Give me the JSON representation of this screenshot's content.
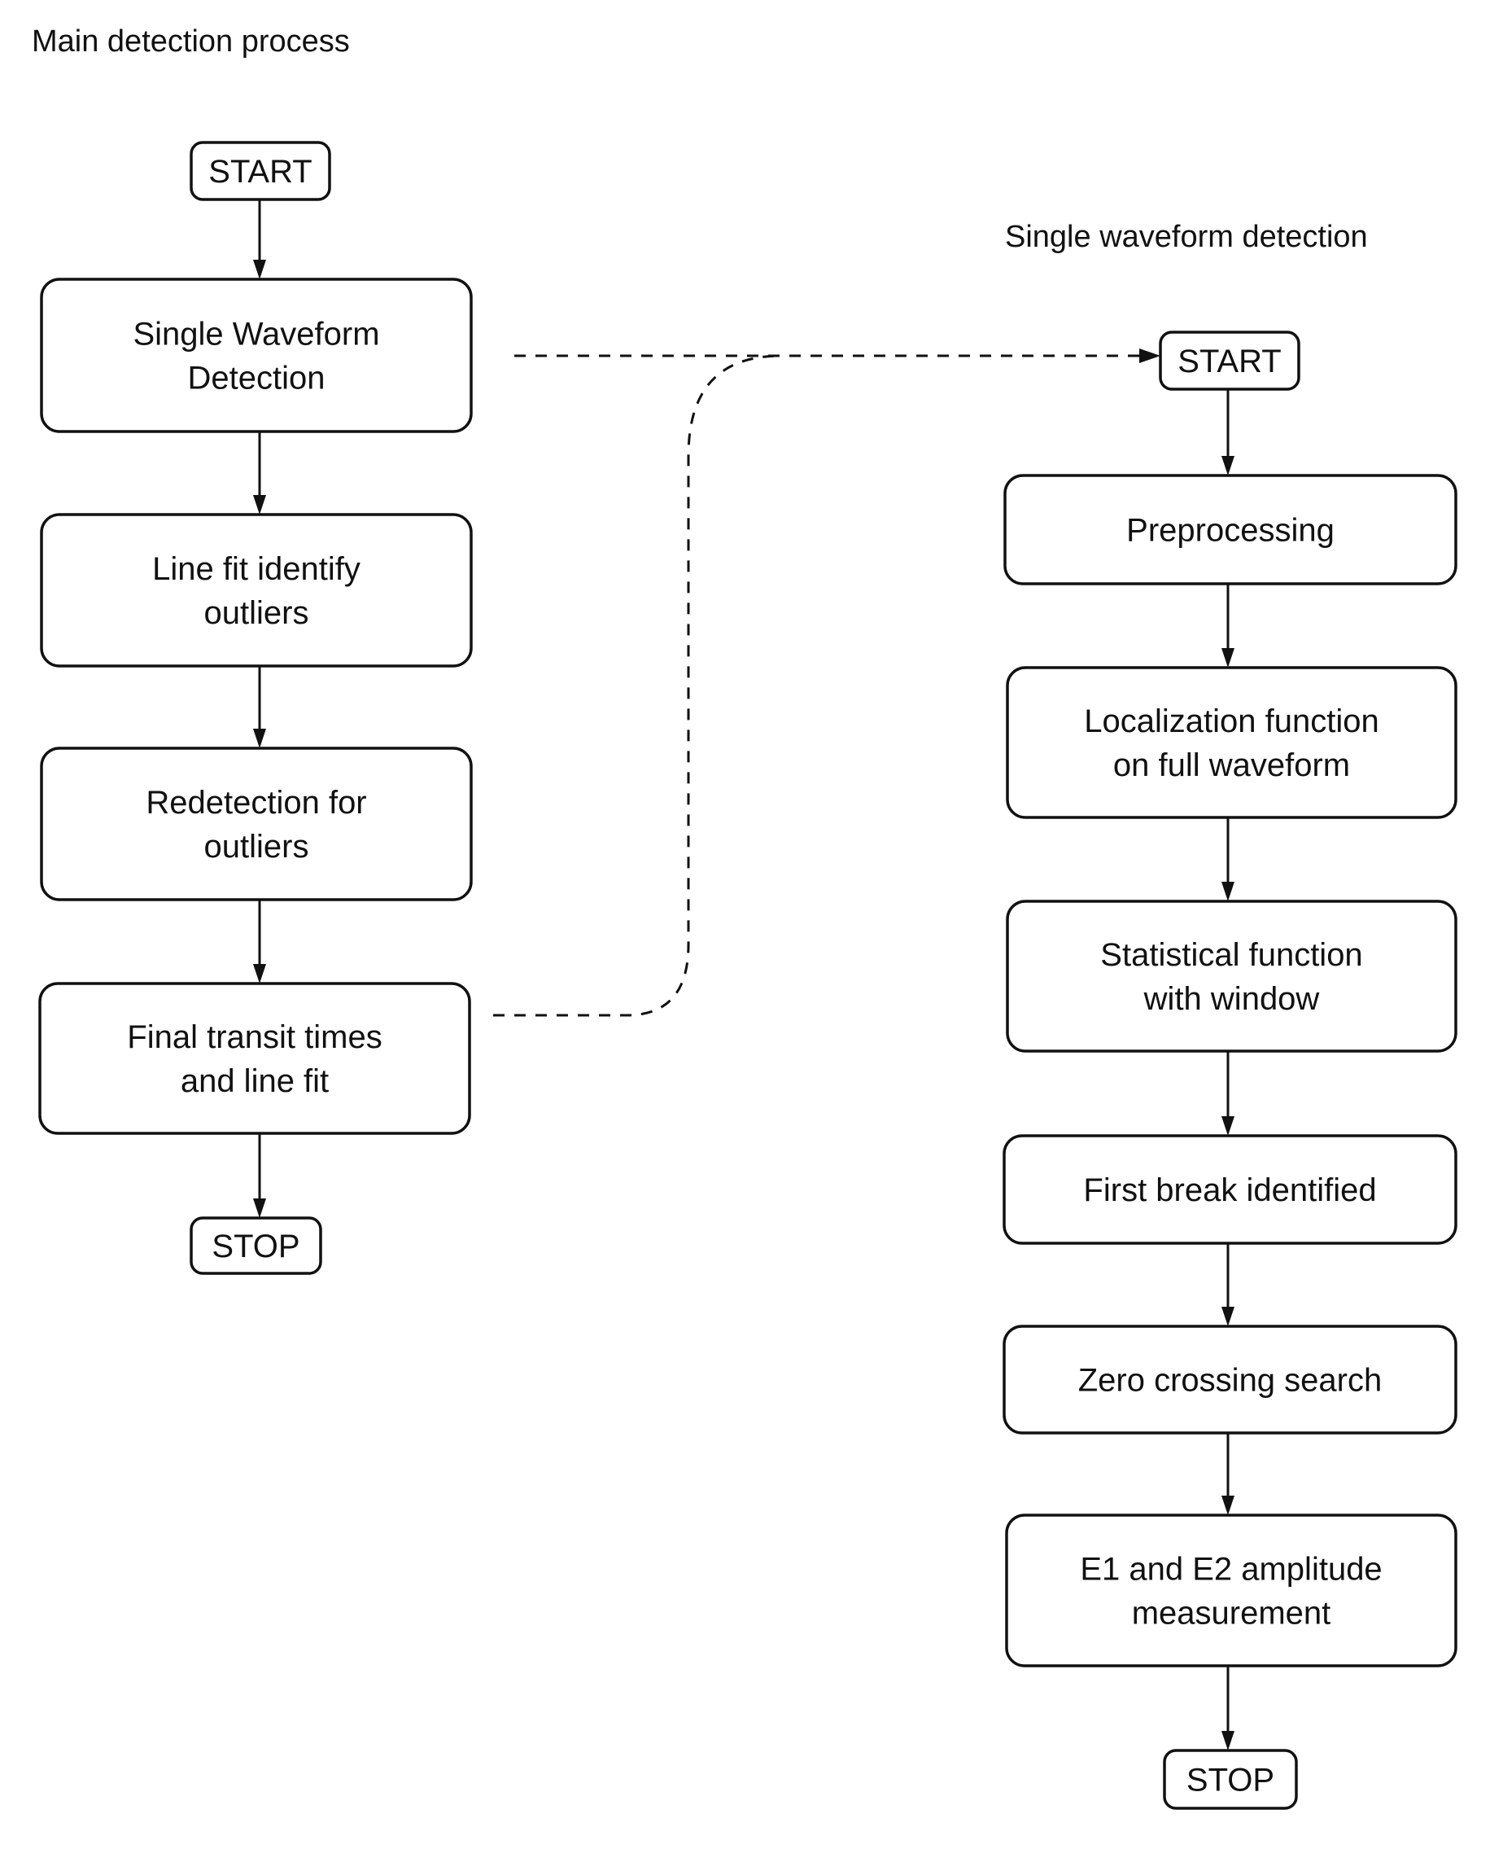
{
  "main_process": {
    "title": "Main detection process",
    "nodes": [
      {
        "id": "start",
        "type": "terminal",
        "lines": [
          "START"
        ]
      },
      {
        "id": "single-waveform-detection",
        "type": "process",
        "lines": [
          "Single Waveform",
          "Detection"
        ]
      },
      {
        "id": "line-fit-identify-outliers",
        "type": "process",
        "lines": [
          "Line fit identify",
          "outliers"
        ]
      },
      {
        "id": "redetection-for-outliers",
        "type": "process",
        "lines": [
          "Redetection for",
          "outliers"
        ]
      },
      {
        "id": "final-transit-times",
        "type": "process",
        "lines": [
          "Final transit times",
          "and line fit"
        ]
      },
      {
        "id": "stop",
        "type": "terminal",
        "lines": [
          "STOP"
        ]
      }
    ]
  },
  "single_waveform": {
    "title": "Single waveform detection",
    "nodes": [
      {
        "id": "start",
        "type": "terminal",
        "lines": [
          "START"
        ]
      },
      {
        "id": "preprocessing",
        "type": "process",
        "lines": [
          "Preprocessing"
        ]
      },
      {
        "id": "localization-function",
        "type": "process",
        "lines": [
          "Localization function",
          "on full waveform"
        ]
      },
      {
        "id": "statistical-function",
        "type": "process",
        "lines": [
          "Statistical function",
          "with window"
        ]
      },
      {
        "id": "first-break-identified",
        "type": "process",
        "lines": [
          "First break identified"
        ]
      },
      {
        "id": "zero-crossing-search",
        "type": "process",
        "lines": [
          "Zero crossing search"
        ]
      },
      {
        "id": "amplitude-measurement",
        "type": "process",
        "lines": [
          "E1 and E2 amplitude",
          "measurement"
        ]
      },
      {
        "id": "stop",
        "type": "terminal",
        "lines": [
          "STOP"
        ]
      }
    ]
  },
  "links": [
    {
      "from": "main_process.single-waveform-detection",
      "to": "single_waveform.start",
      "style": "dashed"
    },
    {
      "from": "main_process.redetection-for-outliers",
      "to": "single_waveform.start",
      "style": "dashed"
    }
  ]
}
